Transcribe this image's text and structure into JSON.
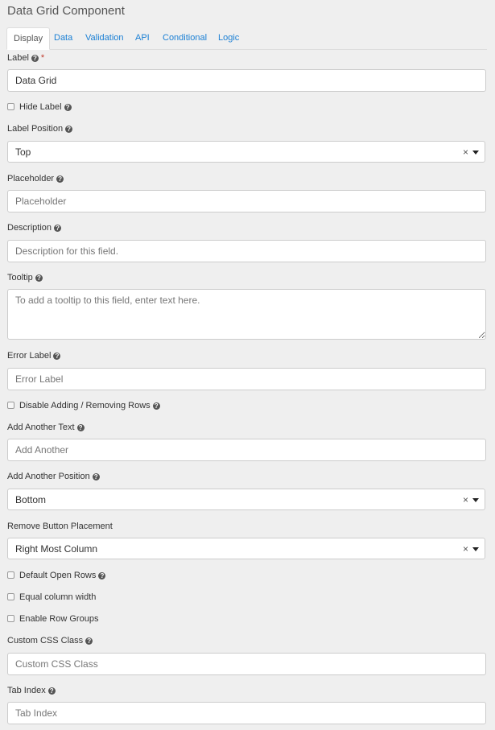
{
  "title": "Data Grid Component",
  "tabs": [
    "Display",
    "Data",
    "Validation",
    "API",
    "Conditional",
    "Logic"
  ],
  "colors": {
    "tab_link": "#1a7fd4",
    "required": "#c0392b",
    "background": "#efefef"
  },
  "fields": {
    "label": {
      "label": "Label",
      "value": "Data Grid"
    },
    "hide_label": {
      "label": "Hide Label"
    },
    "label_position": {
      "label": "Label Position",
      "value": "Top"
    },
    "placeholder": {
      "label": "Placeholder",
      "placeholder": "Placeholder"
    },
    "description": {
      "label": "Description",
      "placeholder": "Description for this field."
    },
    "tooltip": {
      "label": "Tooltip",
      "placeholder": "To add a tooltip to this field, enter text here."
    },
    "error_label": {
      "label": "Error Label",
      "placeholder": "Error Label"
    },
    "disable_adding": {
      "label": "Disable Adding / Removing Rows"
    },
    "add_another_text": {
      "label": "Add Another Text",
      "placeholder": "Add Another"
    },
    "add_another_position": {
      "label": "Add Another Position",
      "value": "Bottom"
    },
    "remove_button_placement": {
      "label": "Remove Button Placement",
      "value": "Right Most Column"
    },
    "default_open_rows": {
      "label": "Default Open Rows"
    },
    "equal_column_width": {
      "label": "Equal column width"
    },
    "enable_row_groups": {
      "label": "Enable Row Groups"
    },
    "custom_css_class": {
      "label": "Custom CSS Class",
      "placeholder": "Custom CSS Class"
    },
    "tab_index": {
      "label": "Tab Index",
      "placeholder": "Tab Index"
    }
  },
  "icons": {
    "help": "question-circle-icon",
    "clear": "×",
    "dropdown": "caret-down-icon"
  }
}
